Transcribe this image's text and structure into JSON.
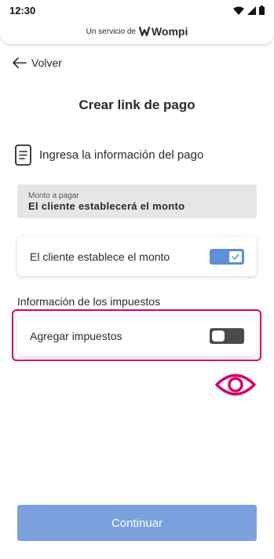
{
  "status_bar": {
    "time": "12:30"
  },
  "brand": {
    "prefix": "Un servicio de",
    "name": "Wompi"
  },
  "nav": {
    "back_label": "Volver"
  },
  "page": {
    "title": "Crear link de pago"
  },
  "section": {
    "header": "Ingresa la información del pago"
  },
  "amount_field": {
    "label": "Monto a pagar",
    "value": "El cliente establecerá el monto"
  },
  "client_amount_toggle": {
    "label": "El cliente establece el monto",
    "checked": true
  },
  "taxes": {
    "title": "Información de los impuestos",
    "add_label": "Agregar impuestos",
    "checked": false
  },
  "actions": {
    "continue_label": "Continuar"
  },
  "colors": {
    "primary": "#7ba0de",
    "toggle_on": "#5f8fd6",
    "toggle_off": "#4a4a4a",
    "highlight": "#d6006b",
    "text": "#2c2a29"
  }
}
